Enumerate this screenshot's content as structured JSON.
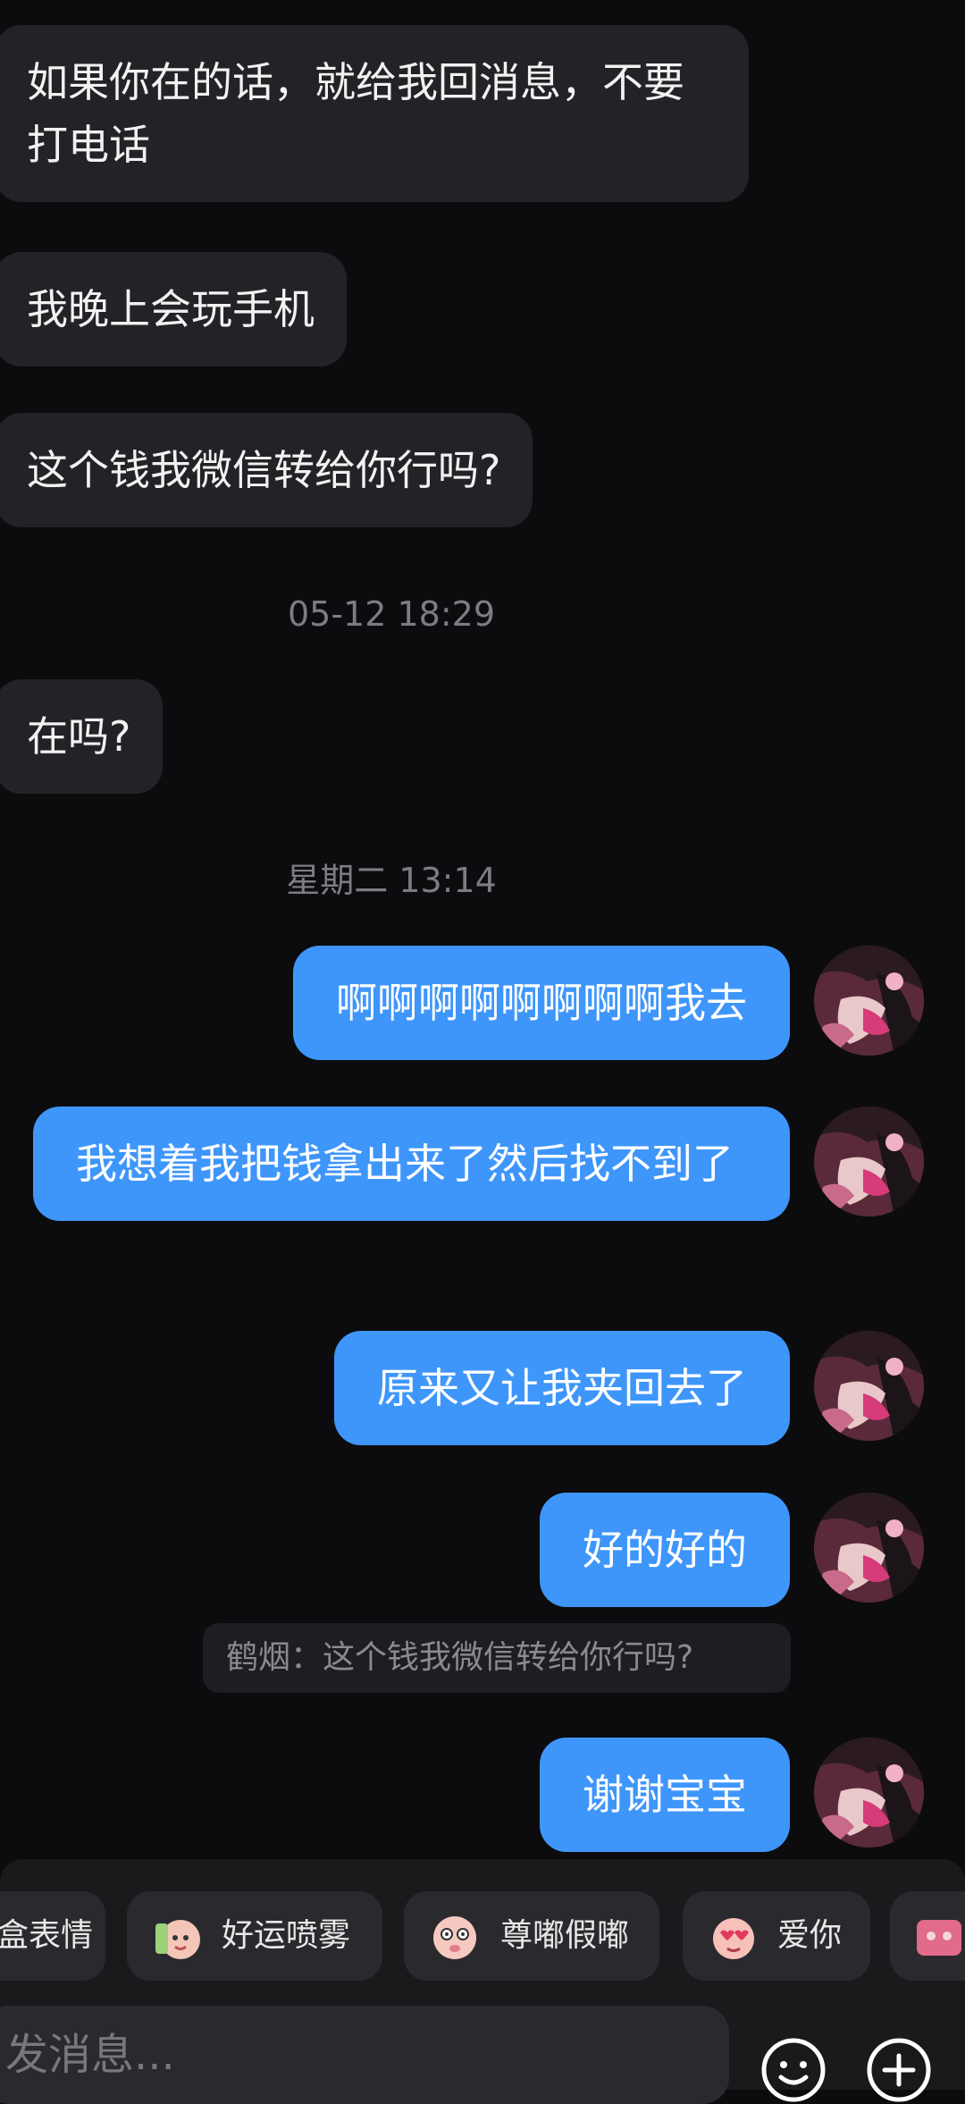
{
  "messages_in": [
    {
      "text": "如果你在的话，就给我回消息，不要打电话"
    },
    {
      "text": "我晚上会玩手机"
    },
    {
      "text": "这个钱我微信转给你行吗?"
    },
    {
      "text": "在吗?"
    }
  ],
  "timestamps": [
    "05-12 18:29",
    "星期二 13:14"
  ],
  "messages_out": [
    {
      "text": "啊啊啊啊啊啊啊啊我去"
    },
    {
      "text": "我想着我把钱拿出来了然后找不到了"
    },
    {
      "text": "原来又让我夹回去了"
    },
    {
      "text": "好的好的"
    },
    {
      "text": "谢谢宝宝"
    }
  ],
  "quote": {
    "text": "鹤烟：这个钱我微信转给你行吗?"
  },
  "stickers": [
    {
      "label": "盒表情",
      "icon": "sticker-partial-icon"
    },
    {
      "label": "好运喷雾",
      "icon": "lucky-spray-sticker-icon"
    },
    {
      "label": "尊嘟假嘟",
      "icon": "really-fake-sticker-icon"
    },
    {
      "label": "爱你",
      "icon": "love-you-sticker-icon"
    }
  ],
  "input": {
    "placeholder": "发消息..."
  },
  "icons": {
    "emoji": "smile-icon",
    "more": "plus-circle-icon"
  },
  "colors": {
    "bubble_out": "#3e96fb",
    "bubble_in": "#232327",
    "background": "#0c0c0e"
  }
}
